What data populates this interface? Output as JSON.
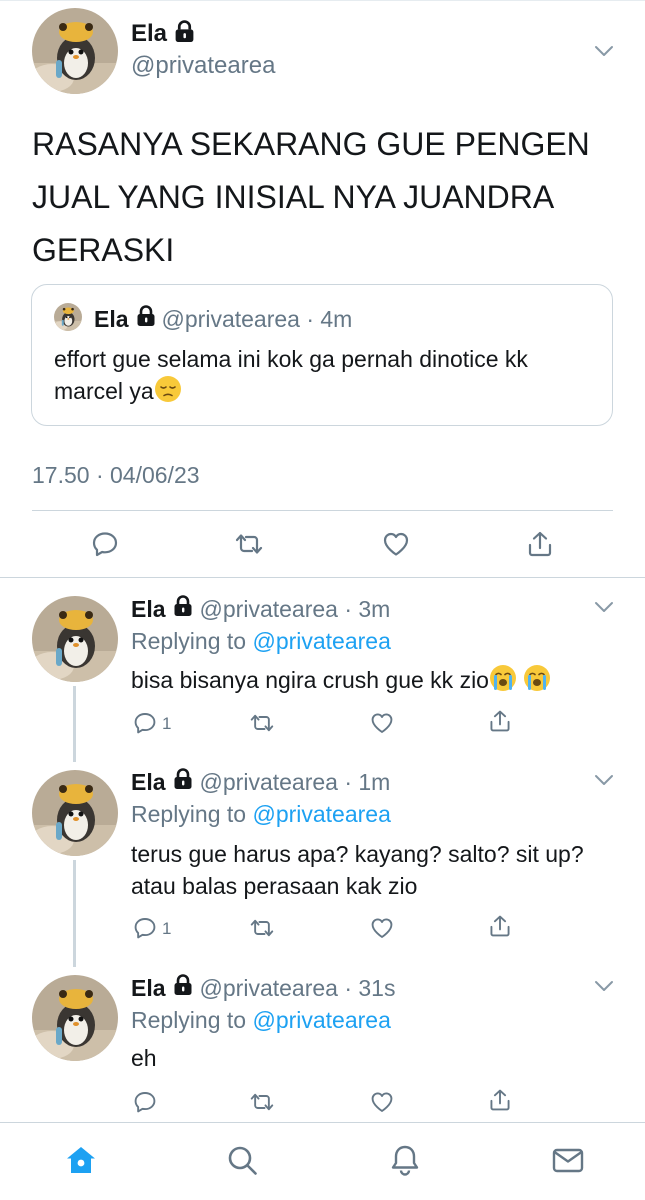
{
  "main_tweet": {
    "author_name": "Ela",
    "author_handle": "@privatearea",
    "locked_icon": "lock-icon",
    "text": "RASANYA SEKARANG GUE PENGEN JUAL YANG INISIAL NYA JUANDRA GERASKI",
    "quoted_tweet": {
      "author_name": "Ela",
      "handle_meta": "@privatearea · 4m",
      "text": "effort gue selama ini kok ga pernah dinotice kk marcel ya",
      "emoji": "pensive-face-emoji"
    },
    "timestamp": "17.50 · 04/06/23",
    "actions": [
      "reply-icon",
      "retweet-icon",
      "like-icon",
      "share-icon"
    ]
  },
  "replies": [
    {
      "author_name": "Ela",
      "meta": "@privatearea · 3m",
      "replying_prefix": "Replying to ",
      "replying_to": "@privatearea",
      "text": "bisa bisanya ngira crush gue kk zio",
      "emojis": [
        "loudly-crying-face-emoji",
        "loudly-crying-face-emoji"
      ],
      "reply_count": "1"
    },
    {
      "author_name": "Ela",
      "meta": "@privatearea · 1m",
      "replying_prefix": "Replying to ",
      "replying_to": "@privatearea",
      "text": "terus gue harus apa? kayang? salto? sit up? atau balas perasaan kak zio",
      "reply_count": "1"
    },
    {
      "author_name": "Ela",
      "meta": "@privatearea · 31s",
      "replying_prefix": "Replying to ",
      "replying_to": "@privatearea",
      "text": "eh",
      "reply_count": ""
    }
  ],
  "tabbar": {
    "tabs": [
      "home-icon",
      "search-icon",
      "notifications-icon",
      "messages-icon"
    ],
    "active": "home-icon"
  },
  "colors": {
    "text": "#14171a",
    "secondary": "#657786",
    "link": "#1da1f2",
    "divider": "#ccd6dd"
  }
}
